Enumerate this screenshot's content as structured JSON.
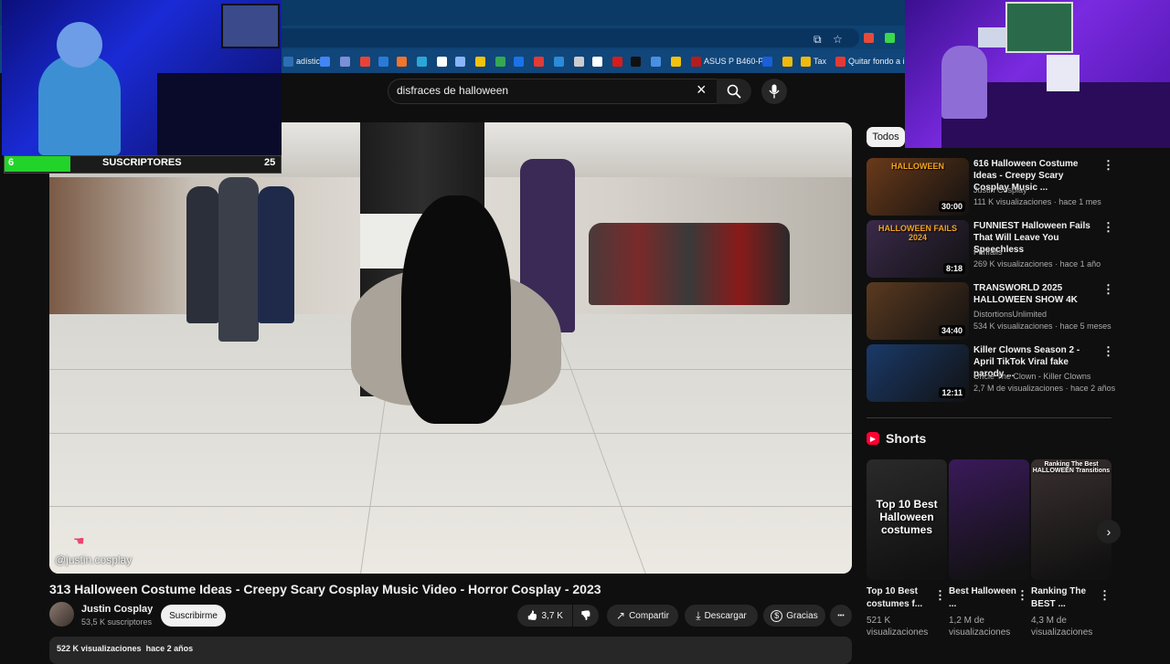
{
  "bookmarks": [
    {
      "label": "adístic...",
      "color": "#2d6fb6"
    },
    {
      "label": "",
      "color": "#4285f4"
    },
    {
      "label": "",
      "color": "#7b8fd6"
    },
    {
      "label": "",
      "color": "#ea4335"
    },
    {
      "label": "",
      "color": "#2a7bd8"
    },
    {
      "label": "",
      "color": "#f4742a"
    },
    {
      "label": "",
      "color": "#2aa7d8"
    },
    {
      "label": "",
      "color": "#ffffff"
    },
    {
      "label": "",
      "color": "#8ab4f8"
    },
    {
      "label": "",
      "color": "#f4c20d"
    },
    {
      "label": "",
      "color": "#34a853"
    },
    {
      "label": "",
      "color": "#1a73e8"
    },
    {
      "label": "",
      "color": "#e53935"
    },
    {
      "label": "",
      "color": "#2a8bd8"
    },
    {
      "label": "",
      "color": "#cccccc"
    },
    {
      "label": "",
      "color": "#ffffff"
    },
    {
      "label": "",
      "color": "#d81b1b"
    },
    {
      "label": "",
      "color": "#111111"
    },
    {
      "label": "",
      "color": "#4a90e2"
    },
    {
      "label": "",
      "color": "#f4c20d"
    },
    {
      "label": "ASUS P B460-P",
      "color": "#b71c1c"
    },
    {
      "label": "",
      "color": "#1a5fd8"
    },
    {
      "label": "",
      "color": "#f0b90b"
    },
    {
      "label": "Tax",
      "color": "#f0b90b"
    },
    {
      "label": "Quitar fondo a im",
      "color": "#e53935"
    }
  ],
  "search": {
    "query": "disfraces de halloween"
  },
  "stream_overlay": {
    "sub_count": "6",
    "sub_label": "SUSCRIPTORES",
    "sub_goal": "25",
    "progress_fraction": 0.24
  },
  "video": {
    "watermark": "@justin.cosplay",
    "title": "313 Halloween Costume Ideas - Creepy Scary Cosplay Music Video - Horror Cosplay - 2023",
    "channel": "Justin Cosplay",
    "subscribers": "53,5 K suscriptores",
    "subscribe_label": "Suscribirme",
    "likes": "3,7 K",
    "share_label": "Compartir",
    "download_label": "Descargar",
    "thanks_label": "Gracias",
    "views": "522 K visualizaciones",
    "date": "hace 2 años"
  },
  "chips": {
    "all": "Todos"
  },
  "recommendations": [
    {
      "title": "616 Halloween Costume Ideas - Creepy Scary Cosplay Music ...",
      "channel": "Justin Cosplay",
      "views": "111 K visualizaciones",
      "age": "hace 1 mes",
      "duration": "30:00",
      "color": "#6a3a1a",
      "thumb_text": "HALLOWEEN"
    },
    {
      "title": "FUNNIEST Halloween Fails That Will Leave You Speechless",
      "channel": "Funfails",
      "views": "269 K visualizaciones",
      "age": "hace 1 año",
      "duration": "8:18",
      "color": "#3a2a4a",
      "thumb_text": "HALLOWEEN FAILS 2024"
    },
    {
      "title": "TRANSWORLD 2025 HALLOWEEN SHOW 4K",
      "channel": "DistortionsUnlimited",
      "views": "534 K visualizaciones",
      "age": "hace 5 meses",
      "duration": "34:40",
      "color": "#5a3a20",
      "thumb_text": ""
    },
    {
      "title": "Killer Clowns Season 2 - April TikTok Viral fake parody ...",
      "channel": "Uncle The Clown - Killer Clowns",
      "views": "2,7 M de visualizaciones",
      "age": "hace 2 años",
      "duration": "12:11",
      "color": "#1a3a6a",
      "thumb_text": ""
    }
  ],
  "shorts": {
    "heading": "Shorts",
    "items": [
      {
        "title": "Top 10 Best costumes f...",
        "views": "521 K visualizaciones",
        "color": "#2a2a2a",
        "overlay": "Top 10 Best Halloween costumes"
      },
      {
        "title": "Best Halloween ...",
        "views": "1,2 M de visualizaciones",
        "color": "#3a1a5a",
        "overlay": ""
      },
      {
        "title": "Ranking The BEST ...",
        "views": "4,3 M de visualizaciones",
        "color": "#3a3030",
        "overlay": "Ranking The Best HALLOWEEN Transitions"
      }
    ]
  },
  "icons": {
    "clear": "×",
    "more": "⋮",
    "next": "›",
    "shorts": "▶",
    "like": "👍",
    "dislike": "👎",
    "share": "↗",
    "download": "⤓",
    "thanks": "$",
    "star": "☆",
    "install": "⧉",
    "ellipsis": "•••"
  }
}
